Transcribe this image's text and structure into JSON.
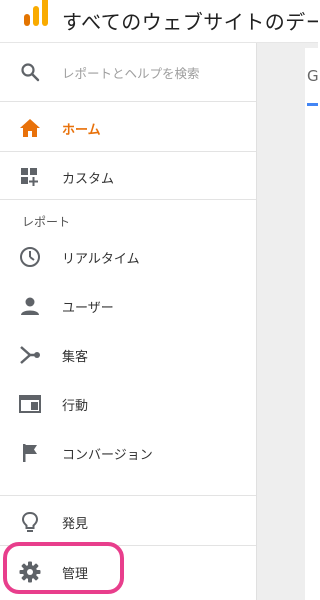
{
  "header": {
    "title": "すべてのウェブサイトのデー"
  },
  "search": {
    "placeholder": "レポートとヘルプを検索",
    "icon": "search-icon"
  },
  "nav": {
    "home": {
      "label": "ホーム",
      "icon": "home-icon"
    },
    "custom": {
      "label": "カスタム",
      "icon": "dashboard-icon"
    },
    "reports_section": "レポート",
    "realtime": {
      "label": "リアルタイム",
      "icon": "clock-icon"
    },
    "users": {
      "label": "ユーザー",
      "icon": "person-icon"
    },
    "acquisition": {
      "label": "集客",
      "icon": "acquisition-icon"
    },
    "behavior": {
      "label": "行動",
      "icon": "browser-window-icon"
    },
    "conversions": {
      "label": "コンバージョン",
      "icon": "flag-icon"
    },
    "discover": {
      "label": "発見",
      "icon": "lightbulb-icon"
    },
    "admin": {
      "label": "管理",
      "icon": "gear-icon"
    }
  },
  "content": {
    "tab_letter": "G"
  },
  "colors": {
    "accent_orange": "#e8710a",
    "highlight_pink": "#e83e8c",
    "icon_gray": "#5f6368",
    "tab_blue": "#4285f4"
  }
}
